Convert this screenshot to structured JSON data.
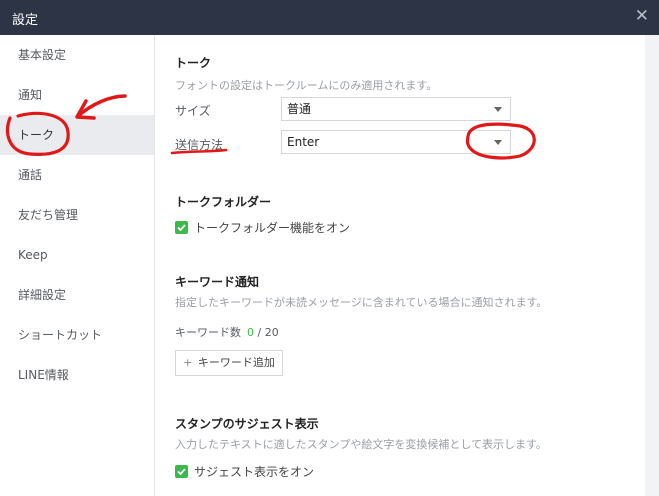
{
  "window": {
    "title": "設定",
    "close_glyph": "✕"
  },
  "sidebar": {
    "items": [
      {
        "label": "基本設定"
      },
      {
        "label": "通知"
      },
      {
        "label": "トーク",
        "active": true
      },
      {
        "label": "通話"
      },
      {
        "label": "友だち管理"
      },
      {
        "label": "Keep"
      },
      {
        "label": "詳細設定"
      },
      {
        "label": "ショートカット"
      },
      {
        "label": "LINE情報"
      }
    ]
  },
  "talk": {
    "title": "トーク",
    "description": "フォントの設定はトークルームにのみ適用されます。",
    "size_label": "サイズ",
    "size_value": "普通",
    "send_label": "送信方法",
    "send_value": "Enter"
  },
  "folder": {
    "title": "トークフォルダー",
    "checkbox_label": "トークフォルダー機能をオン",
    "checked": true
  },
  "keyword": {
    "title": "キーワード通知",
    "description": "指定したキーワードが未読メッセージに含まれている場合に通知されます。",
    "count_label": "キーワード数",
    "count_current": "0",
    "count_total": "/ 20",
    "add_button": "キーワード追加",
    "add_icon": "plus-icon"
  },
  "stamp": {
    "title": "スタンプのサジェスト表示",
    "description": "入力したテキストに適したスタンプや絵文字を変換候補として表示します。",
    "checkbox_label": "サジェスト表示をオン",
    "checked": true
  },
  "colors": {
    "titlebar": "#2c3445",
    "accent_green": "#3cb94a",
    "annotation_red": "#e01818"
  }
}
